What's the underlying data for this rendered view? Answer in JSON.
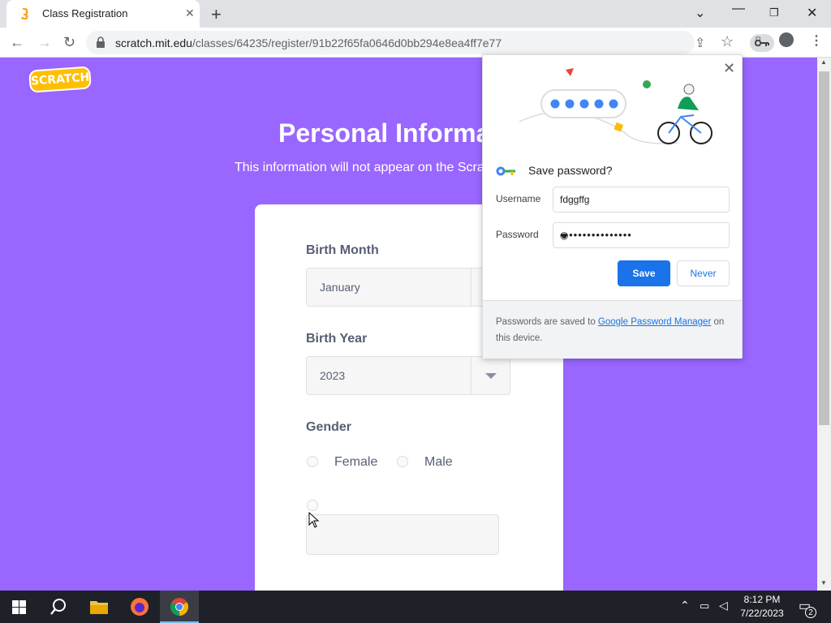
{
  "browser": {
    "tab_title": "Class Registration",
    "url_host": "scratch.mit.edu",
    "url_path": "/classes/64235/register/91b22f65fa0646d0bb294e8ea4ff7e77"
  },
  "page": {
    "logo_text": "SCRATCH",
    "title": "Personal Informa",
    "subtitle": "This information will not appear on the Scra",
    "birth_month_label": "Birth Month",
    "birth_month_value": "January",
    "birth_year_label": "Birth Year",
    "birth_year_value": "2023",
    "gender_label": "Gender",
    "gender_options": [
      "Female",
      "Male"
    ]
  },
  "password_popup": {
    "title": "Save password?",
    "username_label": "Username",
    "username_value": "fdggffg",
    "password_label": "Password",
    "password_value": "••••••••••••••••",
    "save_label": "Save",
    "never_label": "Never",
    "footer_prefix": "Passwords are saved to ",
    "footer_link": "Google Password Manager",
    "footer_suffix": " on this device."
  },
  "taskbar": {
    "time": "8:12 PM",
    "date": "7/22/2023",
    "notification_count": "2"
  },
  "colors": {
    "page_bg": "#9966ff",
    "accent": "#1a73e8"
  }
}
